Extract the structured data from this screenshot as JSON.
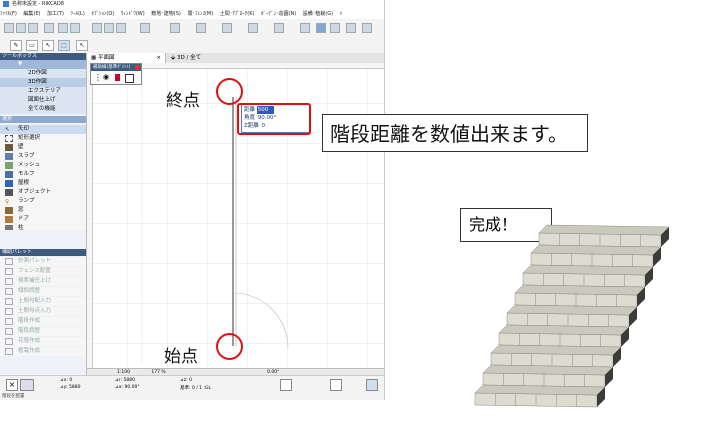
{
  "app": {
    "title": "名称未設定 - RIKCAD8",
    "menu": [
      "ﾌｧｲﾙ(F)",
      "編集(E)",
      "加工(T)",
      "ﾂｰﾙ(L)",
      "ｵﾌﾟｼｮﾝ(O)",
      "ｳｨﾝﾄﾞｳ(W)",
      "敷地･建物(S)",
      "塀･ﾌｪﾝｽ(M)",
      "土間･ｱﾌﾟﾛｰﾁ(K)",
      "ｶﾞｰﾃﾞﾝ･造園(N)",
      "設備･植栽(G)",
      "ﾒ"
    ]
  },
  "panel": {
    "header_toolbox": "ツールボックス",
    "nav_items": [
      "2D作図",
      "3D作図",
      "エクステリア",
      "図面仕上げ",
      "全ての機能"
    ],
    "header_select": "選択",
    "tools": [
      "矢印",
      "矩形選択",
      "壁",
      "スラブ",
      "メッシュ",
      "モルフ",
      "屋根",
      "オブジェクト",
      "ランプ",
      "窓",
      "ドア",
      "柱"
    ],
    "header_palette": "補助パレット",
    "palette_items": [
      "計測パレット",
      "フェンス配置",
      "現実補任上げ",
      "傾斜調整",
      "土間勾配入力",
      "土間勾点入力",
      "階段作成",
      "階段調整",
      "花壇作成",
      "植栽作成"
    ]
  },
  "tabs": {
    "plan": "平面図",
    "view3d": "3D / 全て"
  },
  "palette": {
    "title": "補助線(基準ﾎﾟｲﾝﾄ)"
  },
  "distance_box": {
    "rows": [
      {
        "label": "距離",
        "value": "500"
      },
      {
        "label": "角度",
        "value": "90.00°"
      },
      {
        "label": "Z距離",
        "value": "0"
      }
    ]
  },
  "status": {
    "scale": "1:100",
    "zoom": "177 %",
    "angle": "0.00°"
  },
  "info": {
    "dx": "⊿x: 0",
    "dy": "⊿y: 5880",
    "r": "⊿r: 5880",
    "a": "⊿a: 90.00°",
    "z": "⊿z: 0",
    "ref": "基準: 0 / 1 :GL",
    "message": "階段を配置"
  },
  "annotations": {
    "start_label": "始点",
    "end_label": "終点",
    "callout": "階段距離を数値出来ます。",
    "done": "完成！"
  },
  "stairs": {
    "steps": 9,
    "blocks_per_step": 6,
    "top_color": "#c9c9bd",
    "front_color": "#dedcd0",
    "side_color": "#3b3b37"
  }
}
